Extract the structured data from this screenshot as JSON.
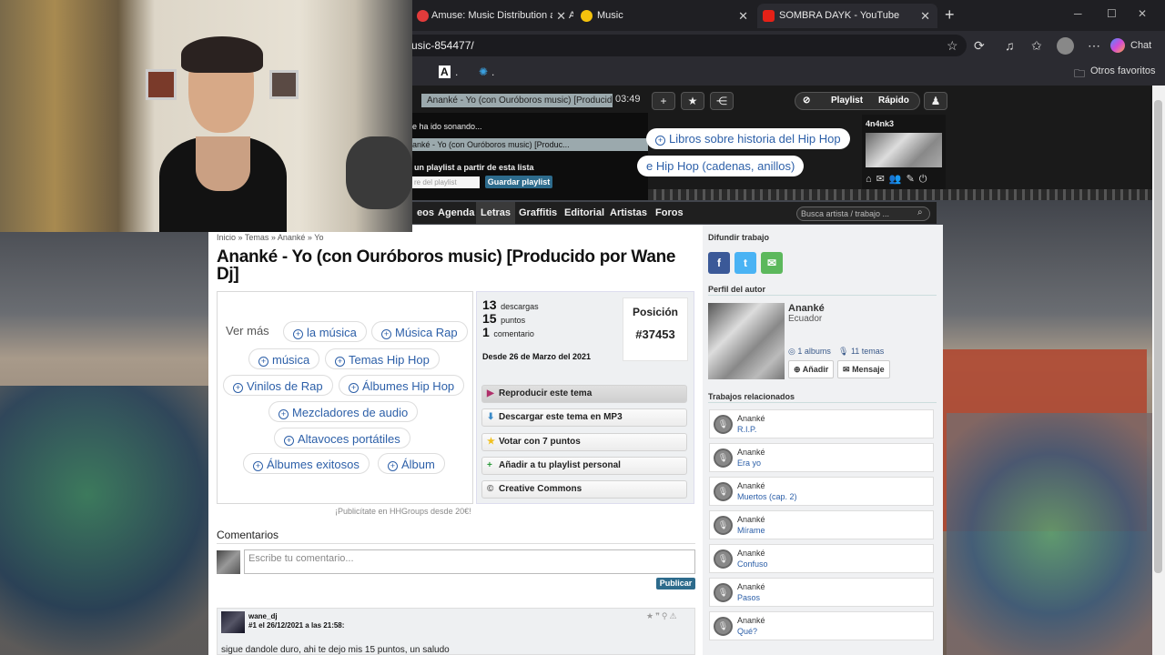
{
  "browser": {
    "tabs": [
      {
        "title": "Amuse: Music Distribution and Art",
        "active": false,
        "favicon_color": "#e23b3b"
      },
      {
        "title": "Music",
        "active": false,
        "favicon_color": "#f4c20d"
      },
      {
        "title": "SOMBRA DAYK - YouTube",
        "active": true,
        "favicon_color": "#e62117"
      }
    ],
    "url": "usic-854477/",
    "chat_label": "Chat",
    "bookmarks": [
      {
        "label": "A"
      },
      {
        "label": "Otros favoritos"
      }
    ]
  },
  "player": {
    "now_playing": "Ananké - Yo (con Ouróboros music) [Producido",
    "time": "03:49",
    "playlist_label": "Playlist",
    "rapido_label": "Rápido",
    "dropdown": {
      "header": "e ha ido sonando...",
      "track": "anké - Yo (con Ouróboros music) [Produc...",
      "create_text": "un playlist a partir de esta lista",
      "input_placeholder": "re del playlist",
      "save_label": "Guardar playlist"
    }
  },
  "top_chips": [
    {
      "label": "Libros sobre historia del Hip Hop"
    },
    {
      "label": "e Hip Hop (cadenas, anillos)"
    }
  ],
  "user_box": {
    "name": "4n4nk3"
  },
  "nav": {
    "items": [
      "eos",
      "Agenda",
      "Letras",
      "Graffitis",
      "Editorial",
      "Artistas",
      "Foros"
    ],
    "selected": "Letras",
    "search_placeholder": "Busca artista / trabajo ..."
  },
  "breadcrumb": [
    "Inicio",
    "Temas",
    "Ananké",
    "Yo"
  ],
  "page_title": "Ananké - Yo (con Ouróboros music) [Producido por Wane Dj]",
  "tags": {
    "ver_mas": "Ver más",
    "items": [
      "la música",
      "Música Rap",
      "música",
      "Temas Hip Hop",
      "Vinilos de Rap",
      "Álbumes Hip Hop",
      "Mezcladores de audio",
      "Altavoces portátiles",
      "Álbumes exitosos",
      "Álbum"
    ]
  },
  "stats": {
    "descargas": "13",
    "descargas_label": "descargas",
    "puntos": "15",
    "puntos_label": "puntos",
    "comentarios": "1",
    "comentarios_label": "comentario",
    "since": "Desde 26 de Marzo del 2021",
    "posicion_label": "Posición",
    "posicion": "#37453"
  },
  "actions": [
    {
      "label": "Reproducir este tema",
      "icon": "play-icon"
    },
    {
      "label": "Descargar este tema en MP3",
      "icon": "download-icon"
    },
    {
      "label": "Votar con 7 puntos",
      "icon": "star-icon"
    },
    {
      "label": "Añadir a tu playlist personal",
      "icon": "plus-icon"
    },
    {
      "label": "Creative Commons",
      "icon": "cc-icon"
    }
  ],
  "ad_note": "¡Publicítate en HHGroups desde 20€!",
  "comments": {
    "heading": "Comentarios",
    "placeholder": "Escribe tu comentario...",
    "publish_label": "Publicar",
    "items": [
      {
        "user": "wane_dj",
        "meta": "#1 el 26/12/2021 a las 21:58:",
        "text": "sigue dandole duro, ahi te dejo mis 15 puntos, un saludo"
      }
    ]
  },
  "sidebar": {
    "share_heading": "Difundir trabajo",
    "author_heading": "Perfil del autor",
    "author_name": "Ananké",
    "author_country": "Ecuador",
    "albums": "1 albums",
    "temas": "11 temas",
    "add_label": "Añadir",
    "msg_label": "Mensaje",
    "related_heading": "Trabajos relacionados",
    "related": [
      {
        "artist": "Ananké",
        "title": "R.I.P."
      },
      {
        "artist": "Ananké",
        "title": "Era yo"
      },
      {
        "artist": "Ananké",
        "title": "Muertos (cap. 2)"
      },
      {
        "artist": "Ananké",
        "title": "Mírame"
      },
      {
        "artist": "Ananké",
        "title": "Confuso"
      },
      {
        "artist": "Ananké",
        "title": "Pasos"
      },
      {
        "artist": "Ananké",
        "title": "Qué?"
      }
    ]
  },
  "colors": {
    "link": "#2c5fa8",
    "facebook": "#3b5998",
    "twitter": "#4ab3f4",
    "email": "#5cb85c",
    "publish": "#2d6b8c"
  }
}
